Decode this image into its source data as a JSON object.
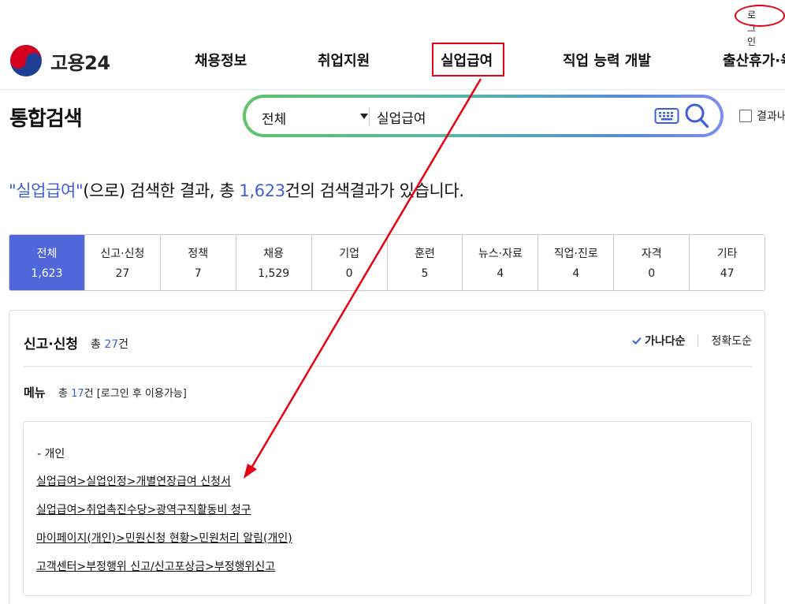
{
  "util": {
    "login_label": "로그인"
  },
  "logo": {
    "text": "고용24"
  },
  "nav": [
    {
      "label": "채용정보"
    },
    {
      "label": "취업지원"
    },
    {
      "label": "실업급여"
    },
    {
      "label": "직업 능력 개발"
    },
    {
      "label": "출산휴가·육"
    }
  ],
  "page_title": "통합검색",
  "search": {
    "scope_selected": "전체",
    "query": "실업급여",
    "keyboard_icon": "keyboard-icon",
    "search_icon": "search-icon"
  },
  "within_results_label": "결과내",
  "summary": {
    "quote_open": "\"",
    "keyword": "실업급여",
    "quote_close": "\"",
    "text_before_total": "(으로) 검색한 결과, 총 ",
    "total": "1,623",
    "text_after_total": "건의 검색결과가 있습니다."
  },
  "categories": [
    {
      "label": "전체",
      "count": "1,623",
      "active": true
    },
    {
      "label": "신고·신청",
      "count": "27"
    },
    {
      "label": "정책",
      "count": "7"
    },
    {
      "label": "채용",
      "count": "1,529"
    },
    {
      "label": "기업",
      "count": "0"
    },
    {
      "label": "훈련",
      "count": "5"
    },
    {
      "label": "뉴스·자료",
      "count": "4"
    },
    {
      "label": "직업·진로",
      "count": "4"
    },
    {
      "label": "자격",
      "count": "0"
    },
    {
      "label": "기타",
      "count": "47"
    }
  ],
  "section": {
    "title": "신고·신청",
    "total_prefix": "총 ",
    "total": "27",
    "total_suffix": "건",
    "sort_active": "가나다순",
    "sort_other": "정확도순",
    "menu": {
      "title": "메뉴",
      "total_prefix": "총 ",
      "total": "17",
      "total_suffix": "건 [로그인 후 이용가능]",
      "group": "- 개인",
      "links": [
        "실업급여>실업인정>개별연장급여 신청서",
        "실업급여>취업촉진수당>광역구직활동비 청구",
        "마이페이지(개인)>민원신청 현황>민원처리 알림(개인)",
        "고객센터>부정행위 신고/신고포상금>부정행위신고"
      ]
    }
  },
  "colors": {
    "accent_blue": "#4f67da",
    "highlight_text": "#3f5fd6",
    "annotation_red": "#e60012"
  }
}
